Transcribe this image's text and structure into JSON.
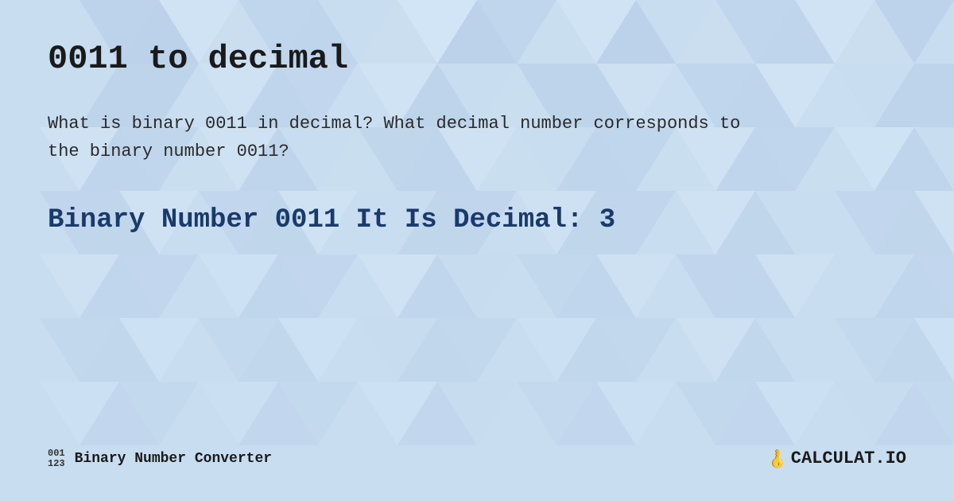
{
  "page": {
    "title": "0011 to decimal",
    "description_part1": "What is binary 0011 in decimal?",
    "description_part2": "What decimal number corresponds to the binary number 0011?",
    "result": "Binary Number 0011 It Is  Decimal: 3",
    "background_color": "#c8ddf0",
    "accent_color": "#1a3a6b"
  },
  "footer": {
    "binary_icon_top": "001",
    "binary_icon_bottom": "123",
    "brand_name": "Binary Number Converter",
    "logo_key_icon": "🔑",
    "logo_text": "CALCULAT.IO"
  }
}
